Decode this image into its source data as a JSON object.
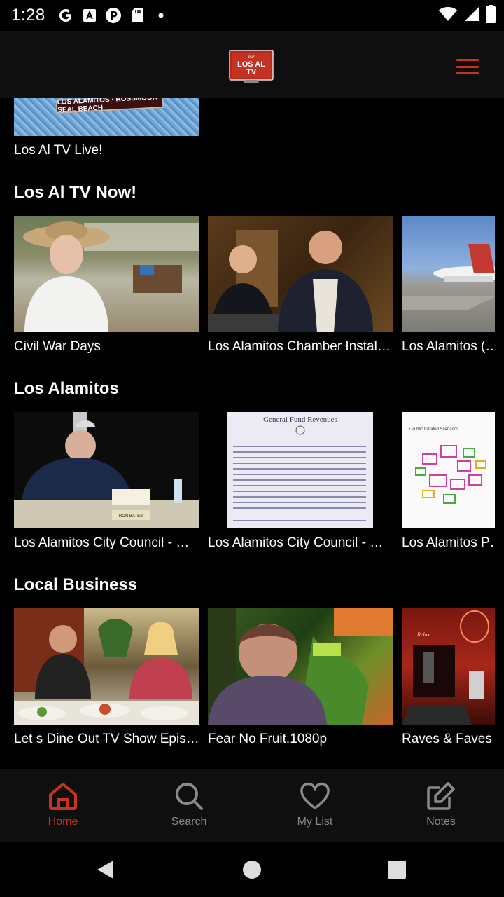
{
  "status_bar": {
    "time": "1:28",
    "left_icons": [
      "google-icon",
      "a-news-icon",
      "p-icon",
      "sd-card-icon",
      "dot-icon"
    ],
    "right_icons": [
      "wifi-icon",
      "signal-icon",
      "battery-icon"
    ]
  },
  "header": {
    "logo_text": "LOS AL TV",
    "logo_small": "our",
    "menu_icon": "hamburger-menu-icon",
    "accent_color": "#c8321e"
  },
  "live": {
    "banner_text": "LOS ALAMITOS · ROSSMOOR · SEAL BEACH",
    "label": "Los Al TV Live!"
  },
  "sections": [
    {
      "title": "Los Al TV Now!",
      "items": [
        {
          "title": "Civil War Days"
        },
        {
          "title": "Los Alamitos Chamber Installation"
        },
        {
          "title": "Los Alamitos (…"
        }
      ]
    },
    {
      "title": "Los Alamitos",
      "items": [
        {
          "title": "Los Alamitos City Council - Meeting"
        },
        {
          "title": "Los Alamitos City Council - Meeting"
        },
        {
          "title": "Los Alamitos P…"
        }
      ]
    },
    {
      "title": "Local Business",
      "items": [
        {
          "title": "   Let s Dine Out    TV Show Episode"
        },
        {
          "title": "Fear No Fruit.1080p"
        },
        {
          "title": "Raves  & Faves"
        }
      ]
    }
  ],
  "thumb_text": {
    "nameplate": "RON BATES",
    "budget_title": "General Fund Revenues",
    "plan_title": "• Public Initiated Scenarios",
    "raves_sign": "Relax"
  },
  "bottom_nav": [
    {
      "label": "Home",
      "icon": "home-icon",
      "active": true
    },
    {
      "label": "Search",
      "icon": "search-icon",
      "active": false
    },
    {
      "label": "My List",
      "icon": "heart-icon",
      "active": false
    },
    {
      "label": "Notes",
      "icon": "edit-note-icon",
      "active": false
    }
  ],
  "system_nav": [
    "back-icon",
    "home-circle-icon",
    "recents-icon"
  ]
}
